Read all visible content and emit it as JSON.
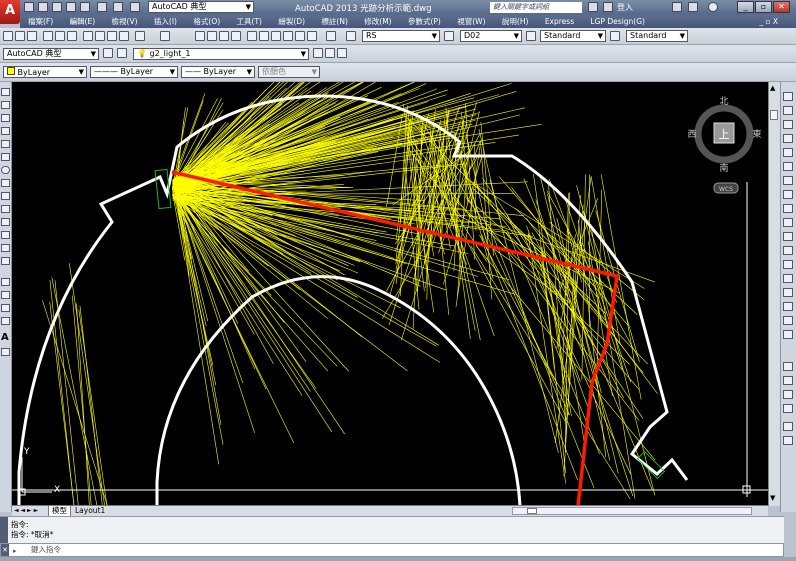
{
  "app": {
    "logo": "A",
    "title": "AutoCAD 2013   光跡分析示範.dwg",
    "workspace": "AutoCAD 典型",
    "search_placeholder": "鍵入關鍵字或詞組",
    "login": "登入"
  },
  "menu": {
    "items": [
      "檔案(F)",
      "編輯(E)",
      "檢視(V)",
      "插入(I)",
      "格式(O)",
      "工具(T)",
      "繪製(D)",
      "標註(N)",
      "修改(M)",
      "參數式(P)",
      "視窗(W)",
      "說明(H)",
      "Express",
      "LGP Design(G)"
    ],
    "controls": "_ ▫ X"
  },
  "toolbar2": {
    "text_style": "RS",
    "dim_style": "D02",
    "table_style": "Standard",
    "multileader_style": "Standard"
  },
  "toolbar3": {
    "workspace": "AutoCAD 典型",
    "layer": "g2_light_1"
  },
  "toolbar4": {
    "color": "ByLayer",
    "linetype": "ByLayer",
    "lineweight": "ByLayer",
    "plotstyle": "依顏色"
  },
  "viewcube": {
    "north": "北",
    "south": "南",
    "west": "西",
    "east": "東",
    "face": "上",
    "wcs": "WCS"
  },
  "ucs": {
    "x": "X",
    "y": "Y"
  },
  "tabs": {
    "nav": "◄ ◄ ► ►",
    "model": "模型",
    "layout": "Layout1"
  },
  "command": {
    "line1": "指令:",
    "line2": "指令: *取消*",
    "prompt": "鍵入指令"
  },
  "colors": {
    "canvas": "#000000",
    "ray": "#ffff00",
    "path": "#ff0000",
    "outline": "#ffffff",
    "sensor": "#0b7a14"
  }
}
